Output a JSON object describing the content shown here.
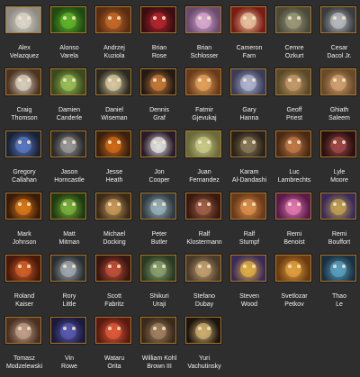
{
  "people": [
    {
      "first": "Alex",
      "last": "Velazquez",
      "bg": "#8d8a83",
      "fg": "#d9d5c9"
    },
    {
      "first": "Alonso",
      "last": "Varela",
      "bg": "#1f4a12",
      "fg": "#62b42a"
    },
    {
      "first": "Andrzej",
      "last": "Kuziola",
      "bg": "#5a2d12",
      "fg": "#c46a2a"
    },
    {
      "first": "Brian",
      "last": "Rose",
      "bg": "#3b0d10",
      "fg": "#b3262c"
    },
    {
      "first": "Brian",
      "last": "Schlosser",
      "bg": "#6a4a6e",
      "fg": "#d9a9cf"
    },
    {
      "first": "Cameron",
      "last": "Farn",
      "bg": "#7a1c14",
      "fg": "#e8c3a0"
    },
    {
      "first": "Cemre",
      "last": "Ozkurt",
      "bg": "#4a4a3a",
      "fg": "#9a9a7a"
    },
    {
      "first": "Cesar",
      "last": "Dacol Jr.",
      "bg": "#3a3c3e",
      "fg": "#b8bcc0"
    },
    {
      "first": "Craig",
      "last": "Thomson",
      "bg": "#4c3422",
      "fg": "#d8cfc0"
    },
    {
      "first": "Damien",
      "last": "Canderle",
      "bg": "#3b4a1c",
      "fg": "#9bbf5a"
    },
    {
      "first": "Daniel",
      "last": "Wiseman",
      "bg": "#2a2a22",
      "fg": "#d9c9a2"
    },
    {
      "first": "Dennis",
      "last": "Graf",
      "bg": "#241a14",
      "fg": "#c77a3a"
    },
    {
      "first": "Fatmir",
      "last": "Gjevukaj",
      "bg": "#6a3a1c",
      "fg": "#e1a35a"
    },
    {
      "first": "Gary",
      "last": "Hanna",
      "bg": "#3a3d5a",
      "fg": "#b0b5d0"
    },
    {
      "first": "Geoff",
      "last": "Priest",
      "bg": "#5a4a2a",
      "fg": "#c49a6a"
    },
    {
      "first": "Ghiath",
      "last": "Saleem",
      "bg": "#6a4a2a",
      "fg": "#d0a070"
    },
    {
      "first": "Gregory",
      "last": "Callahan",
      "bg": "#1a2238",
      "fg": "#5a7ac0"
    },
    {
      "first": "Jason",
      "last": "Horncastle",
      "bg": "#2a2a2a",
      "fg": "#9a9a9a"
    },
    {
      "first": "Jesse",
      "last": "Heath",
      "bg": "#3a200e",
      "fg": "#d06a1a"
    },
    {
      "first": "Jon",
      "last": "Cooper",
      "bg": "#2a1a2a",
      "fg": "#e0e0e0"
    },
    {
      "first": "Juan",
      "last": "Fernandez",
      "bg": "#6a6a3a",
      "fg": "#c9c98a"
    },
    {
      "first": "Karam",
      "last": "Al-Dandashi",
      "bg": "#2a2218",
      "fg": "#8a7a5a"
    },
    {
      "first": "Luc",
      "last": "Lambrechts",
      "bg": "#4a2a14",
      "fg": "#c07a4a"
    },
    {
      "first": "Lyle",
      "last": "Moore",
      "bg": "#2a1010",
      "fg": "#a04a4a"
    },
    {
      "first": "Mark",
      "last": "Johnson",
      "bg": "#3a1a08",
      "fg": "#d87a1a"
    },
    {
      "first": "Matt",
      "last": "Mitman",
      "bg": "#1e3a10",
      "fg": "#7ab03a"
    },
    {
      "first": "Michael",
      "last": "Docking",
      "bg": "#3a2a1a",
      "fg": "#c79a5a"
    },
    {
      "first": "Peter",
      "last": "Butler",
      "bg": "#2e3a40",
      "fg": "#9ab0ba"
    },
    {
      "first": "Ralf",
      "last": "Klostermann",
      "bg": "#3a1a10",
      "fg": "#a0604a"
    },
    {
      "first": "Ralf",
      "last": "Stumpf",
      "bg": "#6a3a1a",
      "fg": "#d8904a"
    },
    {
      "first": "Remi",
      "last": "Benoist",
      "bg": "#5a1a4a",
      "fg": "#e07ab0"
    },
    {
      "first": "Remi",
      "last": "Bouffort",
      "bg": "#3a2a5a",
      "fg": "#c0a050"
    },
    {
      "first": "Roland",
      "last": "Kaiser",
      "bg": "#4a1808",
      "fg": "#d0602a"
    },
    {
      "first": "Rory",
      "last": "Little",
      "bg": "#2a2e30",
      "fg": "#a0a8b0"
    },
    {
      "first": "Scott",
      "last": "Fabritz",
      "bg": "#3a1610",
      "fg": "#c0503a"
    },
    {
      "first": "Shikuri",
      "last": "Uraji",
      "bg": "#2a3a22",
      "fg": "#8aa070"
    },
    {
      "first": "Stefano",
      "last": "Dubay",
      "bg": "#4a3a2a",
      "fg": "#c0a070"
    },
    {
      "first": "Steven",
      "last": "Wood",
      "bg": "#3a2a5a",
      "fg": "#e0b040"
    },
    {
      "first": "Svetlozar",
      "last": "Petkov",
      "bg": "#6a3a10",
      "fg": "#e0a040"
    },
    {
      "first": "Thao",
      "last": "Le",
      "bg": "#1a3040",
      "fg": "#5aa0c0"
    },
    {
      "first": "Tomasz",
      "last": "Modzelewski",
      "bg": "#4a3022",
      "fg": "#c0a08a"
    },
    {
      "first": "Vin",
      "last": "Rowe",
      "bg": "#1a1a3a",
      "fg": "#5a5ab0"
    },
    {
      "first": "Wataru",
      "last": "Orita",
      "bg": "#5a1a10",
      "fg": "#e05a3a"
    },
    {
      "first": "William Kohl",
      "last": "Brown III",
      "bg": "#3a2a1a",
      "fg": "#a08060"
    },
    {
      "first": "Yuri",
      "last": "Vachutinsky",
      "bg": "#1a140e",
      "fg": "#d0b070"
    }
  ]
}
